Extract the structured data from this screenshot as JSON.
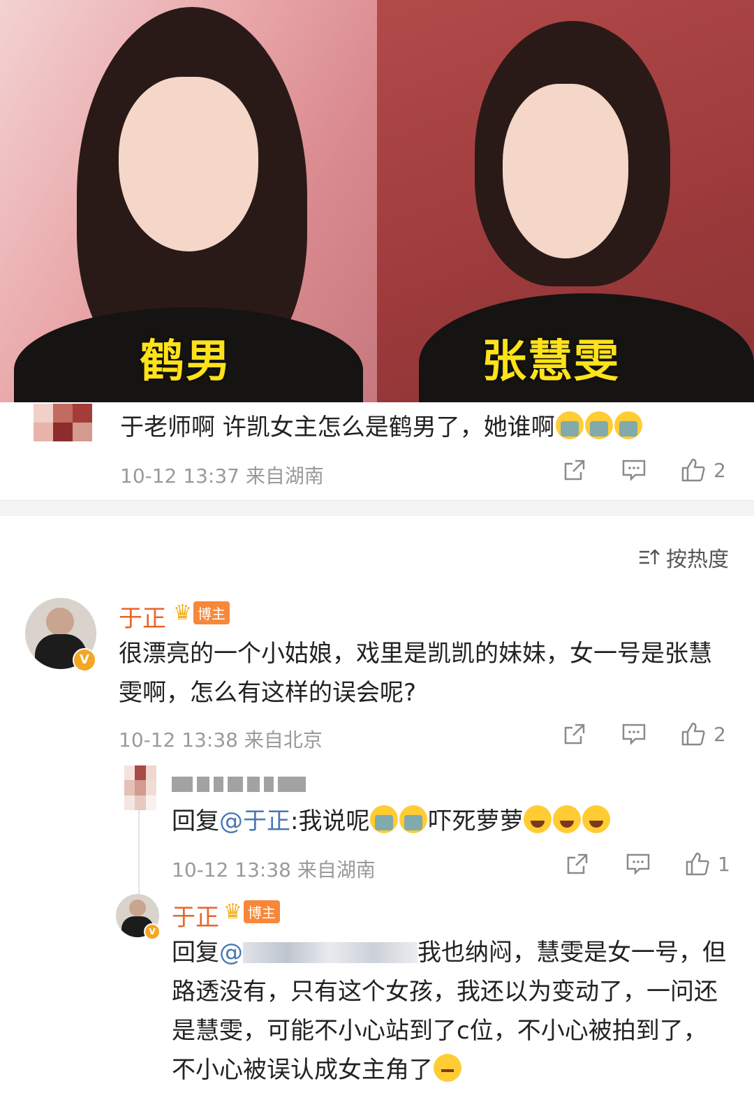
{
  "photos": {
    "left_label": "鹤男",
    "right_label": "张慧雯"
  },
  "post_comment": {
    "text": "于老师啊 许凯女主怎么是鹤男了，她谁啊",
    "time": "10-12 13:37",
    "location": "来自湖南",
    "like_count": "2"
  },
  "sort": {
    "label": "按热度"
  },
  "reply1": {
    "username": "于正",
    "badge": "博主",
    "text": "很漂亮的一个小姑娘，戏里是凯凯的妹妹，女一号是张慧雯啊，怎么有这样的误会呢?",
    "time": "10-12 13:38",
    "location": "来自北京",
    "like_count": "2"
  },
  "reply2": {
    "prefix": "回复",
    "mention": "@于正",
    "text": ":我说呢",
    "text2": "吓死萝萝",
    "time": "10-12 13:38",
    "location": "来自湖南",
    "like_count": "1"
  },
  "reply3": {
    "username": "于正",
    "badge": "博主",
    "prefix": "回复",
    "mention": "@",
    "text": "我也纳闷，慧雯是女一号，但路透没有，只有这个女孩，我还以为变动了，一问还是慧雯，可能不小心站到了c位，不小心被拍到了，不小心被误认成女主角了"
  },
  "icons": {
    "share": "share-icon",
    "comment": "comment-icon",
    "like": "thumbs-up-icon",
    "sort": "sort-icon",
    "crown": "crown-icon",
    "verified": "verified-v-icon"
  }
}
